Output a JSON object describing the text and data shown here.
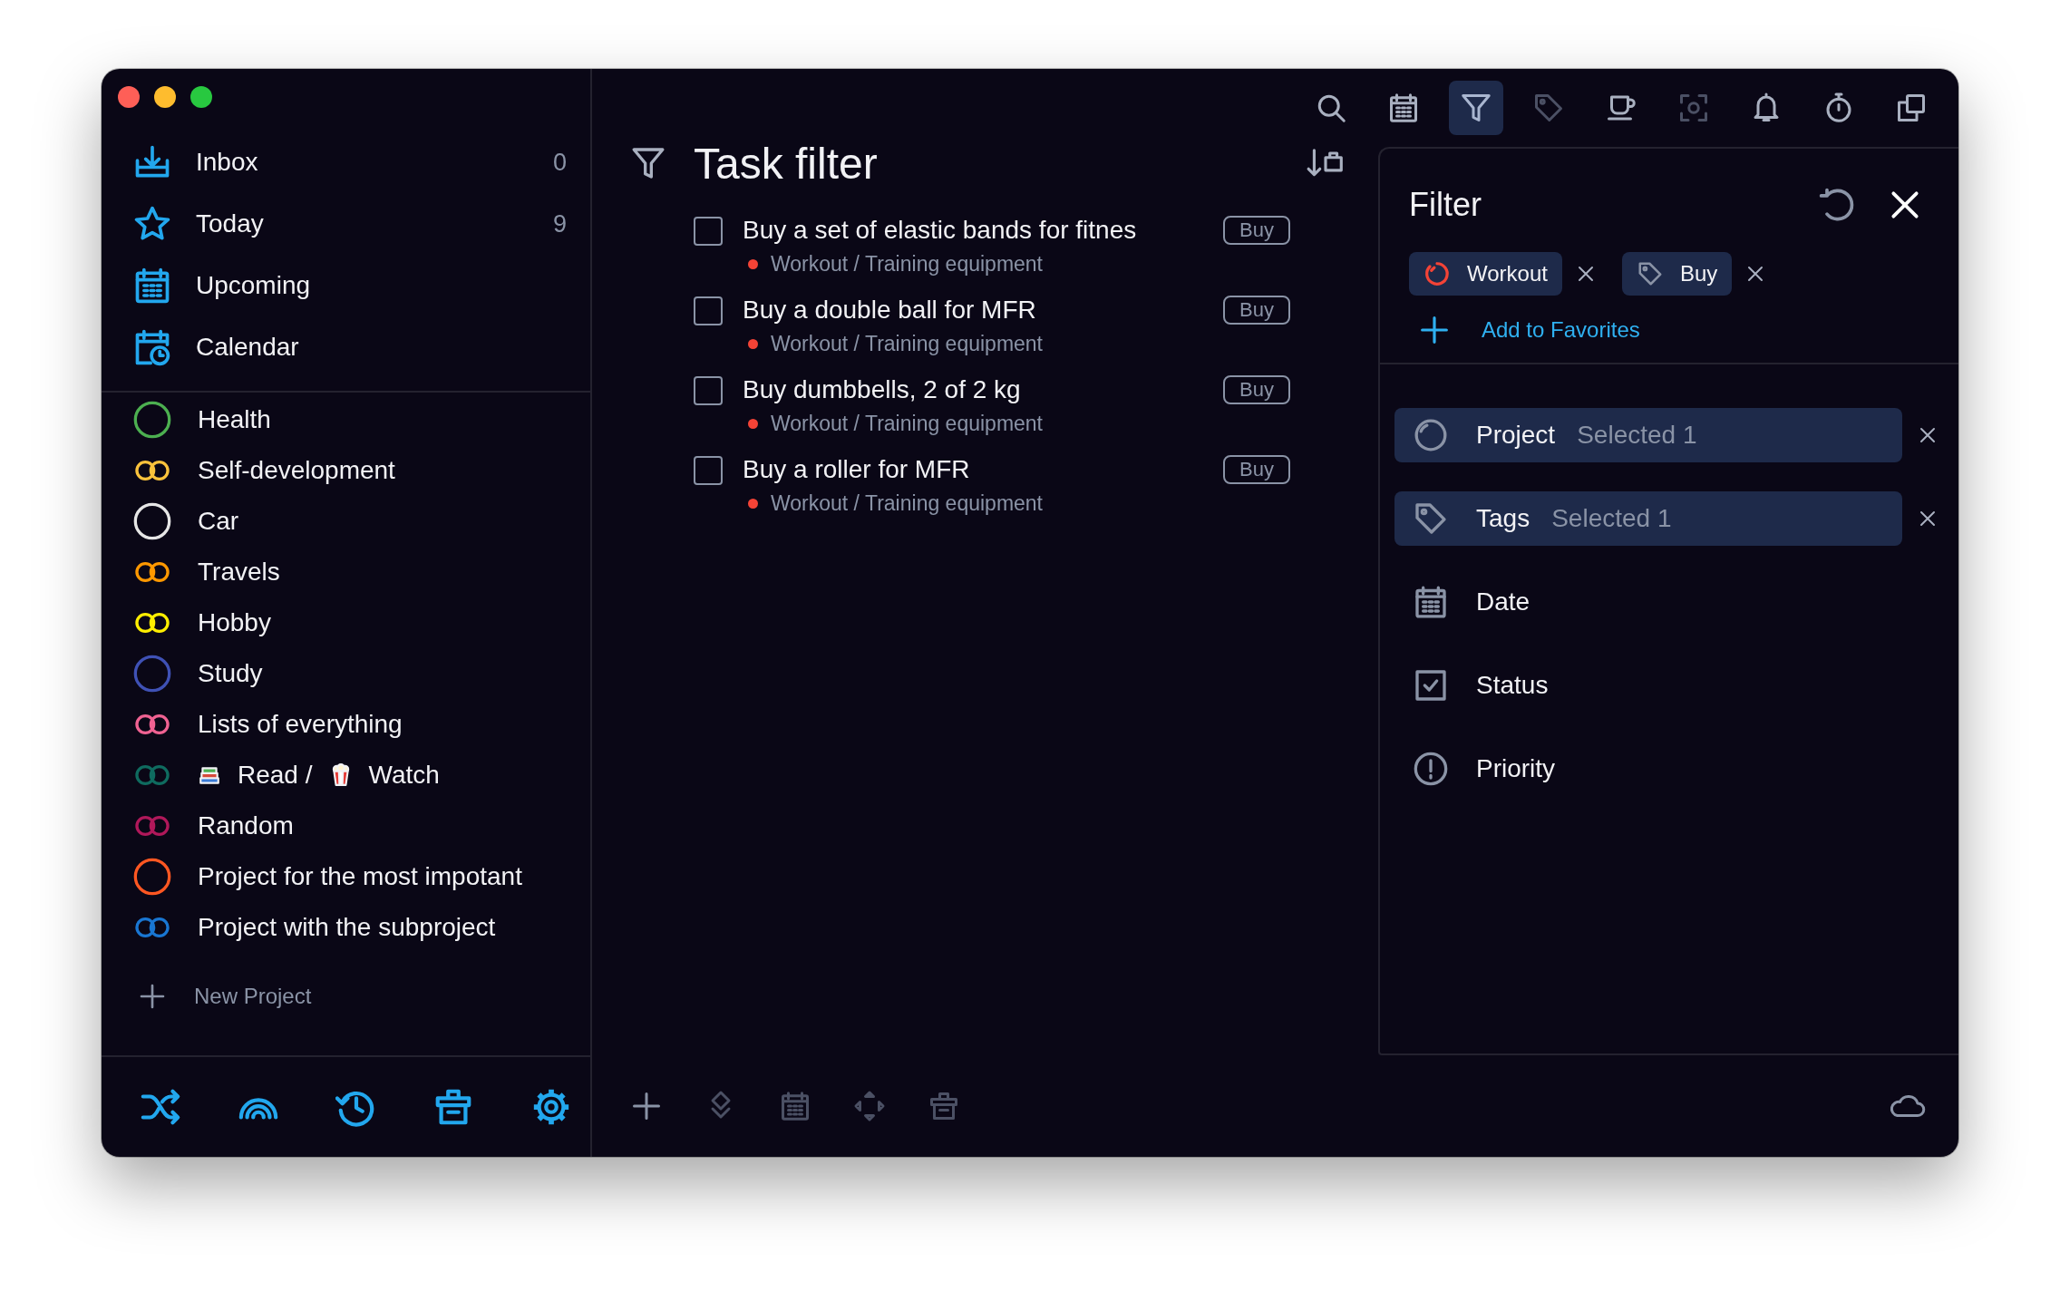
{
  "window": {
    "traffic_lights": [
      {
        "color": "#fe5f57"
      },
      {
        "color": "#febc2e"
      },
      {
        "color": "#28c840"
      }
    ]
  },
  "sidebar": {
    "nav": [
      {
        "kind": "inbox",
        "label": "Inbox",
        "count": "0"
      },
      {
        "kind": "star",
        "label": "Today",
        "count": "9"
      },
      {
        "kind": "upcoming",
        "label": "Upcoming"
      },
      {
        "kind": "calendar",
        "label": "Calendar"
      }
    ],
    "projects": [
      {
        "kind": "ring",
        "color": "#4caf50",
        "label": "Health"
      },
      {
        "kind": "double",
        "color": "#f9c23c",
        "label": "Self-development"
      },
      {
        "kind": "ring",
        "color": "#e6e6e6",
        "label": "Car"
      },
      {
        "kind": "double",
        "color": "#ff9800",
        "label": "Travels"
      },
      {
        "kind": "double",
        "color": "#ffee00",
        "label": "Hobby"
      },
      {
        "kind": "ring",
        "color": "#3f51b5",
        "label": "Study"
      },
      {
        "kind": "double",
        "color": "#f06292",
        "label": "Lists of everything"
      },
      {
        "kind": "double",
        "color": "#0f6b5f",
        "label_parts": [
          "Read /",
          "Watch"
        ]
      },
      {
        "kind": "double",
        "color": "#b0185a",
        "label": "Random"
      },
      {
        "kind": "ring",
        "color": "#ff5722",
        "label": "Project for the most impotant"
      },
      {
        "kind": "double",
        "color": "#1976d2",
        "label": "Project with the subproject"
      }
    ],
    "new_project": "New Project",
    "tools": [
      {
        "kind": "shuffle"
      },
      {
        "kind": "rainbow"
      },
      {
        "kind": "history"
      },
      {
        "kind": "trash"
      },
      {
        "kind": "settings"
      }
    ]
  },
  "toolbar": [
    {
      "kind": "search",
      "selected": false,
      "disabled": false
    },
    {
      "kind": "calendar",
      "selected": false,
      "disabled": false
    },
    {
      "kind": "filter",
      "selected": true,
      "disabled": false
    },
    {
      "kind": "tag",
      "selected": false,
      "disabled": true
    },
    {
      "kind": "cup",
      "selected": false,
      "disabled": false
    },
    {
      "kind": "focus",
      "selected": false,
      "disabled": true
    },
    {
      "kind": "bell",
      "selected": false,
      "disabled": false
    },
    {
      "kind": "timer",
      "selected": false,
      "disabled": false
    },
    {
      "kind": "copy",
      "selected": false,
      "disabled": false
    }
  ],
  "content": {
    "title": "Task filter",
    "tasks": [
      {
        "title": "Buy a set of elastic bands for fitnes",
        "checked": false,
        "color": "#f44336",
        "path": "Workout / Training equipment",
        "tag": "Buy"
      },
      {
        "title": "Buy a double ball for MFR",
        "checked": false,
        "color": "#f44336",
        "path": "Workout / Training equipment",
        "tag": "Buy"
      },
      {
        "title": "Buy dumbbells, 2 of 2 kg",
        "checked": false,
        "color": "#f44336",
        "path": "Workout / Training equipment",
        "tag": "Buy"
      },
      {
        "title": "Buy a roller for MFR",
        "checked": false,
        "color": "#f44336",
        "path": "Workout / Training equipment",
        "tag": "Buy"
      }
    ]
  },
  "filter": {
    "title": "Filter",
    "chips": [
      {
        "kind": "project",
        "label": "Workout",
        "color": "#f44336"
      },
      {
        "kind": "tag",
        "label": "Buy"
      }
    ],
    "add_favorites": "Add to Favorites",
    "criteria": [
      {
        "kind": "project",
        "label": "Project",
        "detail": "Selected 1",
        "active": true
      },
      {
        "kind": "tag",
        "label": "Tags",
        "detail": "Selected 1",
        "active": true
      },
      {
        "kind": "date",
        "label": "Date",
        "active": false
      },
      {
        "kind": "status",
        "label": "Status",
        "active": false
      },
      {
        "kind": "priority",
        "label": "Priority",
        "active": false
      }
    ]
  },
  "bottom_bar": {
    "tools": [
      {
        "kind": "add",
        "disabled": false
      },
      {
        "kind": "diamond",
        "disabled": true
      },
      {
        "kind": "calendar",
        "disabled": true
      },
      {
        "kind": "move",
        "disabled": true
      },
      {
        "kind": "trash",
        "disabled": true
      }
    ]
  }
}
